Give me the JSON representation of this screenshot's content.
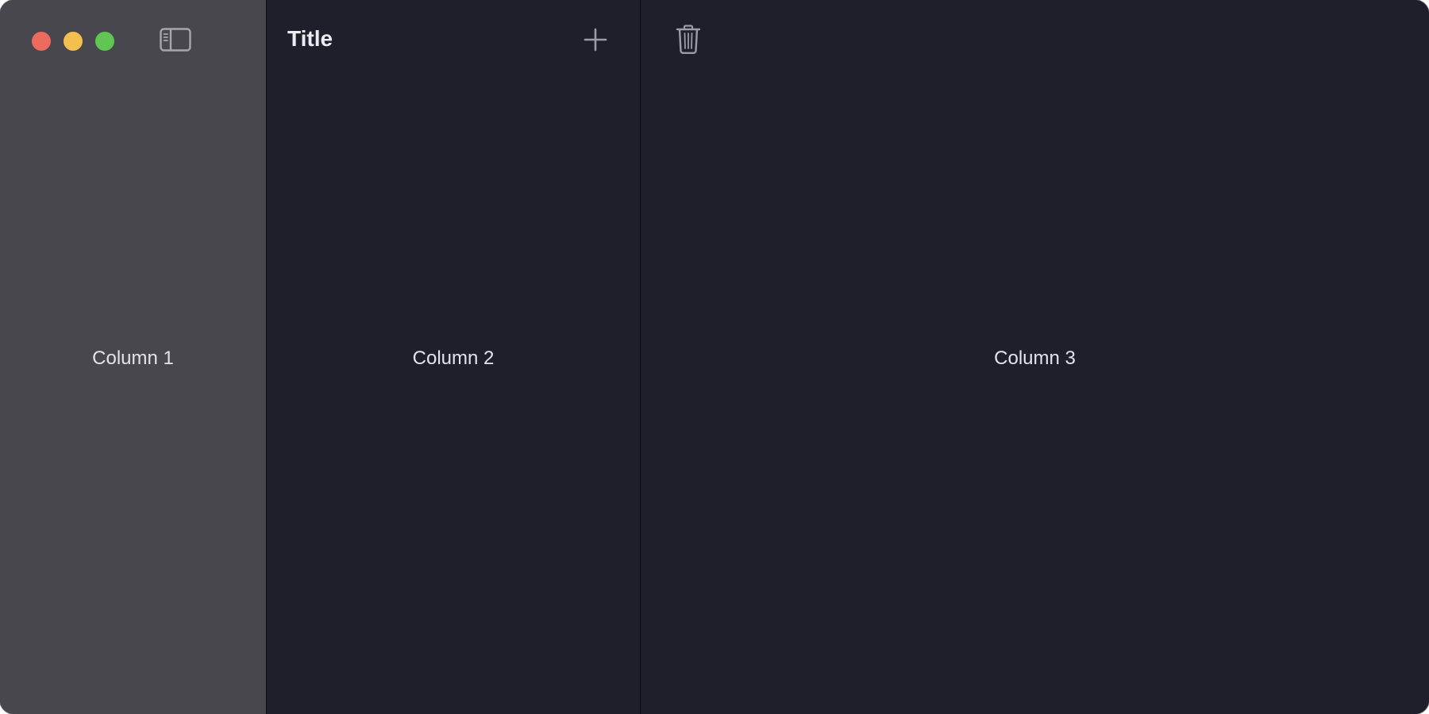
{
  "window": {
    "traffic_lights": {
      "close": "#ec6a5e",
      "minimize": "#f4bf4f",
      "zoom": "#61c554"
    }
  },
  "sidebar": {
    "toggle_icon": "sidebar-left-icon",
    "label": "Column 1",
    "background": "#48474d"
  },
  "content": {
    "title": "Title",
    "add_icon": "plus-icon",
    "label": "Column 2",
    "background": "#1f1e2b"
  },
  "detail": {
    "trash_icon": "trash-icon",
    "label": "Column 3",
    "background": "#1f1e2b"
  }
}
